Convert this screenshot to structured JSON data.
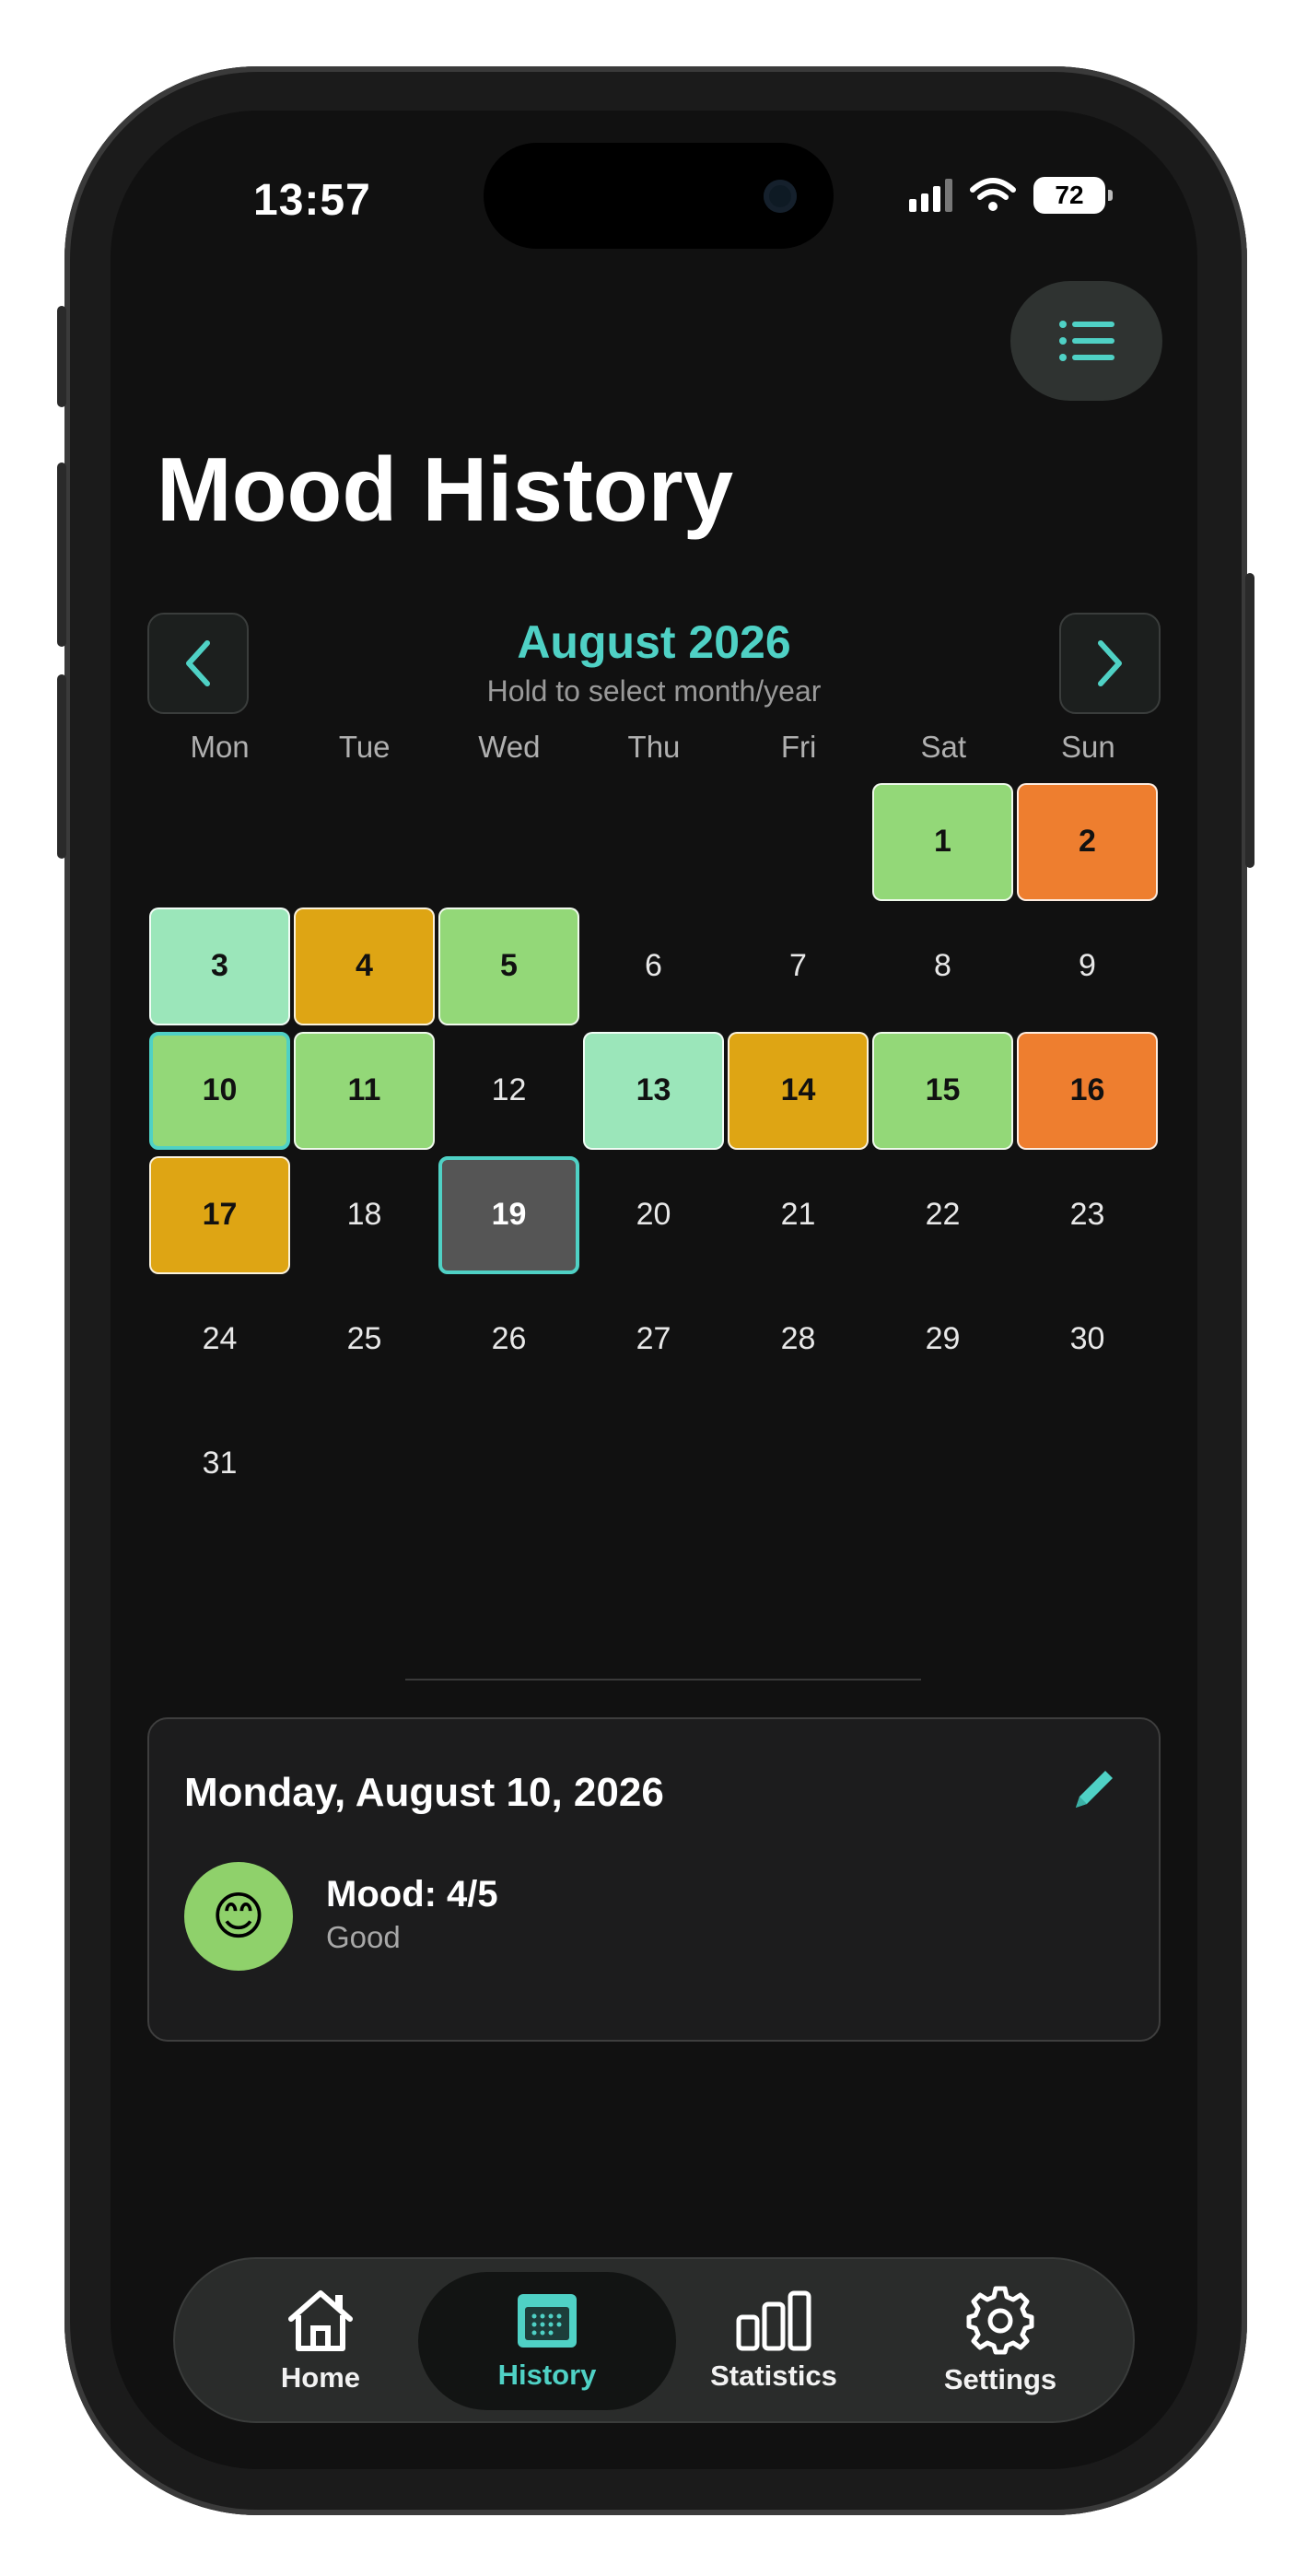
{
  "status_bar": {
    "time": "13:57",
    "battery": "72"
  },
  "page": {
    "title": "Mood History"
  },
  "calendar": {
    "month_label": "August 2026",
    "hint": "Hold to select month/year",
    "weekdays": [
      "Mon",
      "Tue",
      "Wed",
      "Thu",
      "Fri",
      "Sat",
      "Sun"
    ],
    "leading_blanks": 5,
    "days": [
      {
        "d": "1",
        "color": "#93d878"
      },
      {
        "d": "2",
        "color": "#ee7e2f"
      },
      {
        "d": "3",
        "color": "#9be6ba"
      },
      {
        "d": "4",
        "color": "#dea514"
      },
      {
        "d": "5",
        "color": "#93d878"
      },
      {
        "d": "6"
      },
      {
        "d": "7"
      },
      {
        "d": "8"
      },
      {
        "d": "9"
      },
      {
        "d": "10",
        "color": "#93d878",
        "selected": true
      },
      {
        "d": "11",
        "color": "#93d878"
      },
      {
        "d": "12"
      },
      {
        "d": "13",
        "color": "#9be6ba"
      },
      {
        "d": "14",
        "color": "#dea514"
      },
      {
        "d": "15",
        "color": "#93d878"
      },
      {
        "d": "16",
        "color": "#ee7e2f"
      },
      {
        "d": "17",
        "color": "#dea514"
      },
      {
        "d": "18"
      },
      {
        "d": "19",
        "today": true
      },
      {
        "d": "20"
      },
      {
        "d": "21"
      },
      {
        "d": "22"
      },
      {
        "d": "23"
      },
      {
        "d": "24"
      },
      {
        "d": "25"
      },
      {
        "d": "26"
      },
      {
        "d": "27"
      },
      {
        "d": "28"
      },
      {
        "d": "29"
      },
      {
        "d": "30"
      },
      {
        "d": "31"
      }
    ]
  },
  "detail": {
    "date": "Monday, August 10, 2026",
    "emoji": "😊",
    "score": "Mood: 4/5",
    "label": "Good",
    "avatar_color": "#8fd16b"
  },
  "tabs": [
    {
      "label": "Home",
      "icon": "home-icon"
    },
    {
      "label": "History",
      "icon": "calendar-icon",
      "active": true
    },
    {
      "label": "Statistics",
      "icon": "bar-chart-icon"
    },
    {
      "label": "Settings",
      "icon": "gear-icon"
    }
  ],
  "colors": {
    "accent": "#4fd1c5",
    "background": "#111111"
  }
}
